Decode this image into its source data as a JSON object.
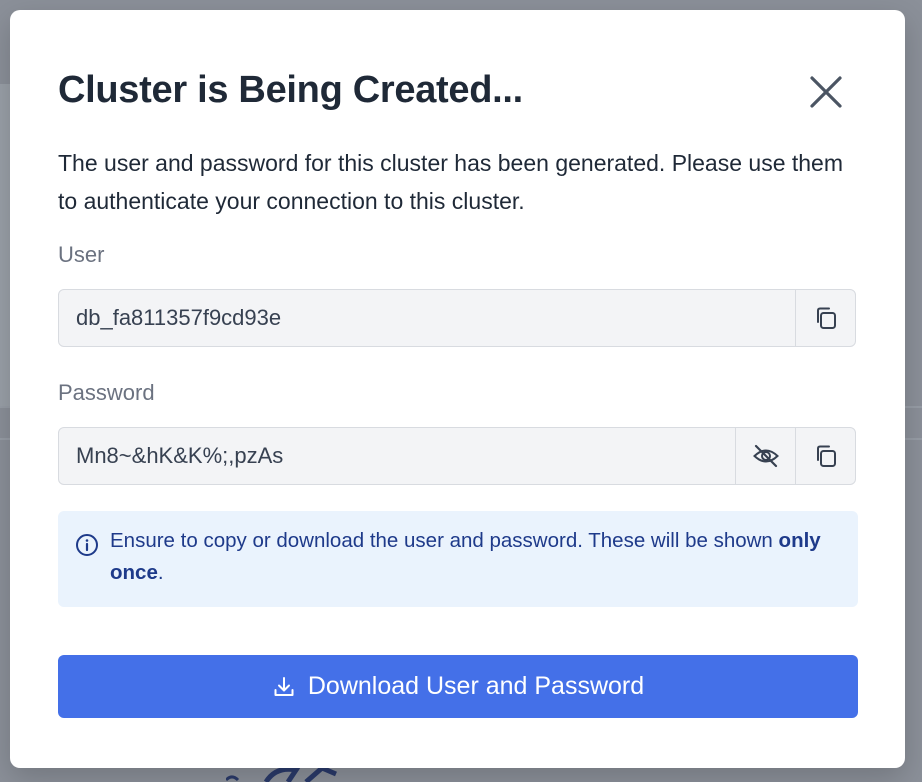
{
  "modal": {
    "title": "Cluster is Being Created...",
    "description": "The user and password for this cluster has been generated. Please use them to authenticate your connection to this cluster.",
    "user": {
      "label": "User",
      "value": "db_fa811357f9cd93e"
    },
    "password": {
      "label": "Password",
      "value": "Mn8~&hK&K%;,pzAs"
    },
    "notice": {
      "text_before": "Ensure to copy or download the user and password. These will be shown ",
      "emphasis": "only once",
      "text_after": "."
    },
    "download_label": "Download User and Password"
  },
  "colors": {
    "primary": "#4470e8",
    "info_bg": "#eaf3fd",
    "info_text": "#1e3a8a"
  },
  "icons": [
    "close-icon",
    "copy-icon",
    "eye-off-icon",
    "info-icon",
    "download-icon"
  ]
}
